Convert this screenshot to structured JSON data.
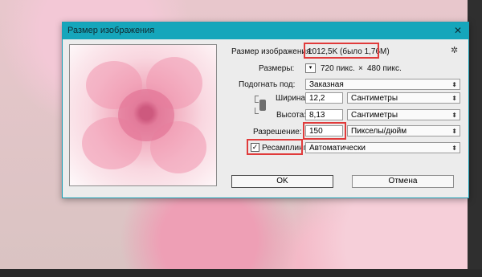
{
  "dialog": {
    "title": "Размер изображения",
    "image_size_label": "Размер изображения:",
    "image_size_value": "1012,5K (было 1,76M)",
    "dimensions_label": "Размеры:",
    "dimensions_width": "720 пикс.",
    "dimensions_times": "×",
    "dimensions_height": "480 пикс.",
    "fit_label": "Подогнать под:",
    "fit_value": "Заказная",
    "width_label": "Ширина:",
    "width_value": "12,2",
    "width_unit": "Сантиметры",
    "height_label": "Высота:",
    "height_value": "8,13",
    "height_unit": "Сантиметры",
    "resolution_label": "Разрешение:",
    "resolution_value": "150",
    "resolution_unit": "Пикселы/дюйм",
    "resample_label": "Ресамплинг:",
    "resample_checked": "✓",
    "resample_value": "Автоматически",
    "ok_label": "OK",
    "cancel_label": "Отмена",
    "close_glyph": "✕",
    "gear_glyph": "✲",
    "dd_glyph": "▾",
    "arrow_glyph": "⬍"
  },
  "colors": {
    "titlebar": "#15a6bb",
    "highlight": "#e03b3b"
  }
}
